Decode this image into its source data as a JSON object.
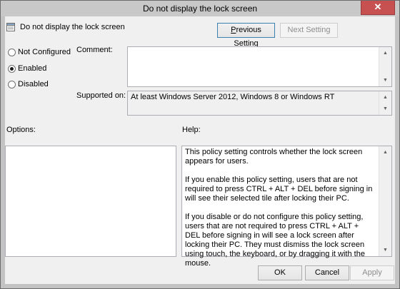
{
  "window": {
    "title": "Do not display the lock screen",
    "close_glyph": "✕"
  },
  "policy": {
    "name": "Do not display the lock screen"
  },
  "buttons": {
    "previous": "Previous Setting",
    "next": "Next Setting",
    "ok": "OK",
    "cancel": "Cancel",
    "apply": "Apply"
  },
  "state": {
    "options": [
      {
        "label": "Not Configured",
        "selected": false
      },
      {
        "label": "Enabled",
        "selected": true
      },
      {
        "label": "Disabled",
        "selected": false
      }
    ]
  },
  "comment": {
    "label": "Comment:",
    "value": ""
  },
  "supported": {
    "label": "Supported on:",
    "value": "At least Windows Server 2012, Windows 8 or Windows RT"
  },
  "options_label": "Options:",
  "help": {
    "label": "Help:",
    "paragraphs": [
      "This policy setting controls whether the lock screen appears for users.",
      "If you enable this policy setting, users that are not required to press CTRL + ALT + DEL before signing in will see their selected tile after  locking their PC.",
      "If you disable or do not configure this policy setting, users that are not required to press CTRL + ALT + DEL before signing in will see a lock screen after locking their PC. They must dismiss the lock screen using touch, the keyboard, or by dragging it with the mouse."
    ]
  },
  "icons": {
    "close": "close-icon",
    "policy": "policy-setting-icon",
    "scroll_up": "scroll-up-arrow",
    "scroll_down": "scroll-down-arrow"
  }
}
